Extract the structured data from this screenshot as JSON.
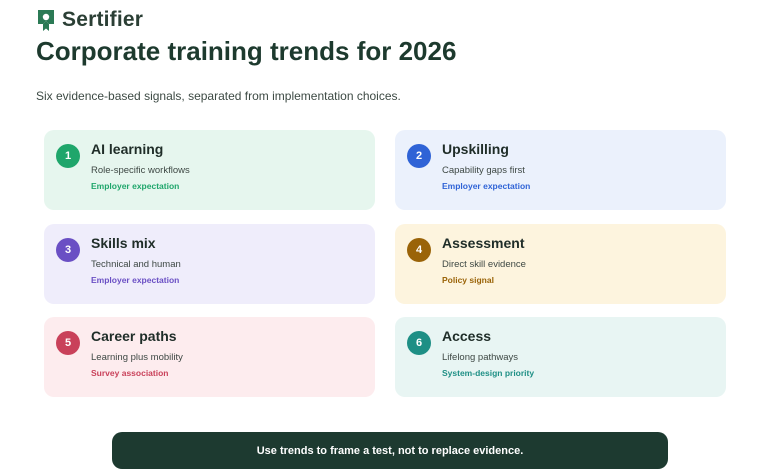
{
  "brand": {
    "name": "Sertifier",
    "icon": "certificate-badge-icon",
    "color": "#2b7a55"
  },
  "header": {
    "title": "Corporate training trends for 2026",
    "subtitle": "Six evidence-based signals, separated from implementation choices."
  },
  "cards": [
    {
      "number": "1",
      "title": "AI learning",
      "description": "Role-specific workflows",
      "tag": "Employer expectation",
      "accent": "#1fa66b"
    },
    {
      "number": "2",
      "title": "Upskilling",
      "description": "Capability gaps first",
      "tag": "Employer expectation",
      "accent": "#2f63d6"
    },
    {
      "number": "3",
      "title": "Skills mix",
      "description": "Technical and human",
      "tag": "Employer expectation",
      "accent": "#6a4fc4"
    },
    {
      "number": "4",
      "title": "Assessment",
      "description": "Direct skill evidence",
      "tag": "Policy signal",
      "accent": "#9a6308"
    },
    {
      "number": "5",
      "title": "Career paths",
      "description": "Learning plus mobility",
      "tag": "Survey association",
      "accent": "#c9415a"
    },
    {
      "number": "6",
      "title": "Access",
      "description": "Lifelong pathways",
      "tag": "System-design priority",
      "accent": "#1e8f85"
    }
  ],
  "banner": {
    "text": "Use trends to frame a test, not to replace evidence."
  }
}
